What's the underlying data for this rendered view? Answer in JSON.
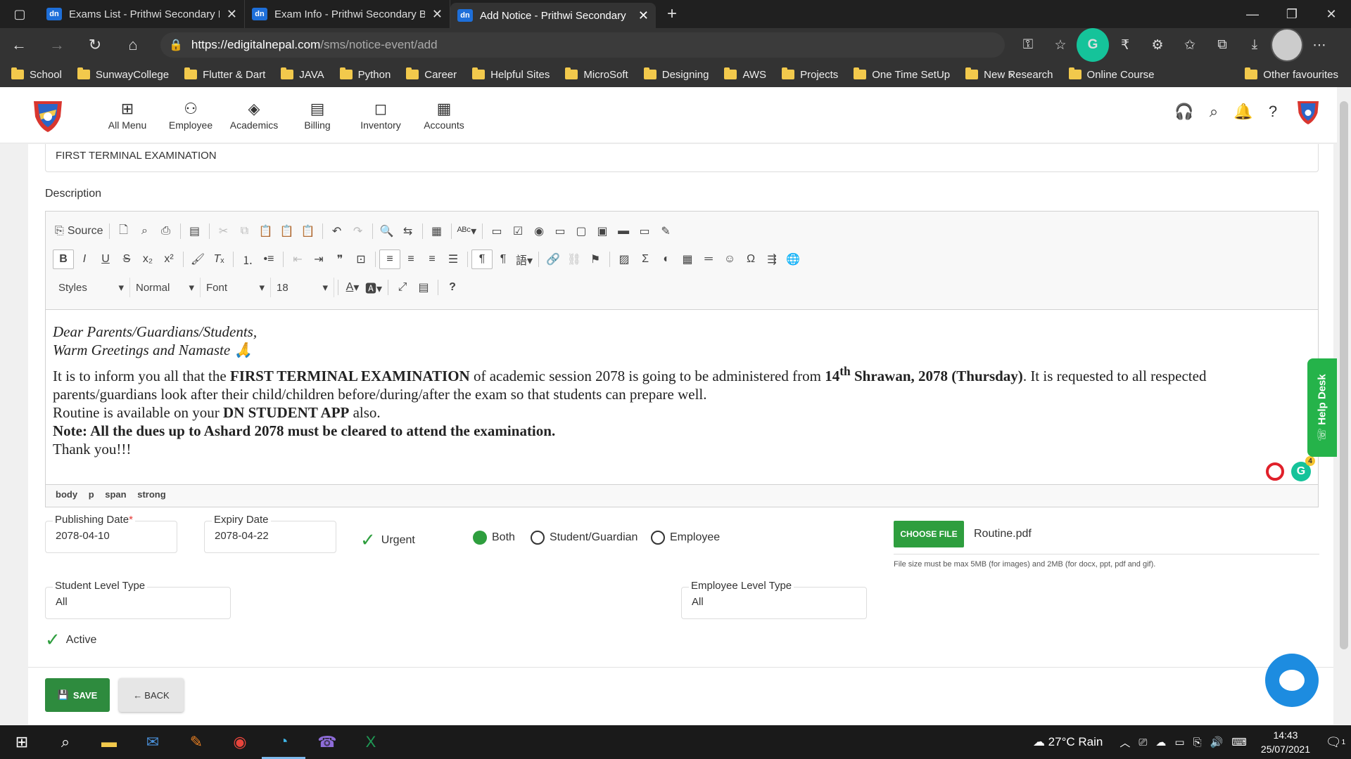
{
  "browser": {
    "tabs": [
      {
        "label": "Exams List - Prithwi Secondary B",
        "favicon": "dn"
      },
      {
        "label": "Exam Info - Prithwi Secondary Bo",
        "favicon": "dn"
      },
      {
        "label": "Add Notice - Prithwi Secondary",
        "favicon": "dn"
      }
    ],
    "url_host": "https://edigitalnepal.com",
    "url_path": "/sms/notice-event/add",
    "bookmarks": [
      "School",
      "SunwayCollege",
      "Flutter & Dart",
      "JAVA",
      "Python",
      "Career",
      "Helpful Sites",
      "MicroSoft",
      "Designing",
      "AWS",
      "Projects",
      "One Time SetUp",
      "New Research",
      "Online Course"
    ],
    "other_favourites": "Other favourites"
  },
  "app": {
    "menu": [
      {
        "label": "All Menu",
        "icon": "grid-icon"
      },
      {
        "label": "Employee",
        "icon": "people-icon"
      },
      {
        "label": "Academics",
        "icon": "layers-icon"
      },
      {
        "label": "Billing",
        "icon": "receipt-icon"
      },
      {
        "label": "Inventory",
        "icon": "bag-icon"
      },
      {
        "label": "Accounts",
        "icon": "calculator-icon"
      }
    ]
  },
  "form": {
    "title_value": "FIRST TERMINAL EXAMINATION",
    "description_label": "Description",
    "toolbar": {
      "source": "Source",
      "styles": "Styles",
      "format": "Normal",
      "font": "Font",
      "size": "18"
    },
    "body": {
      "line1": "Dear Parents/Guardians/Students,",
      "line2": "Warm Greetings and Namaste",
      "line3_a": "It is to inform you all that the ",
      "line3_b": "FIRST TERMINAL EXAMINATION",
      "line3_c": " of academic session 2078 is going to be administered from ",
      "line3_d": "14",
      "line3_sup": "th",
      "line3_e": " Shrawan, 2078 (Thursday)",
      "line3_f": ". It is requested to all respected parents/guardians look after their child/children before/during/after the exam so that students can prepare well.",
      "line4_a": "Routine is available on your ",
      "line4_b": "DN STUDENT APP",
      "line4_c": " also.",
      "line5": "Note: All the dues up to Ashard 2078 must be cleared to attend the examination.",
      "line6": "Thank you!!!"
    },
    "grammarly_count": "4",
    "path": [
      "body",
      "p",
      "span",
      "strong"
    ],
    "publishing_date": {
      "label": "Publishing Date",
      "value": "2078-04-10"
    },
    "expiry_date": {
      "label": "Expiry Date",
      "value": "2078-04-22"
    },
    "urgent": "Urgent",
    "audience": {
      "both": "Both",
      "student": "Student/Guardian",
      "employee": "Employee",
      "selected": "Both"
    },
    "choose_file": "CHOOSE FILE",
    "file_name": "Routine.pdf",
    "file_hint": "File size must be max 5MB (for images) and 2MB (for docx, ppt, pdf and gif).",
    "student_level": {
      "label": "Student Level Type",
      "value": "All"
    },
    "employee_level": {
      "label": "Employee Level Type",
      "value": "All"
    },
    "active": "Active",
    "save": "SAVE",
    "back": "BACK"
  },
  "help_desk": "Help Desk",
  "taskbar": {
    "weather": "27°C  Rain",
    "time": "14:43",
    "date": "25/07/2021",
    "notifications": "1"
  },
  "colors": {
    "primary_green": "#2e9e3e",
    "help_green": "#25b34a",
    "chat_blue": "#1d8ce0"
  }
}
